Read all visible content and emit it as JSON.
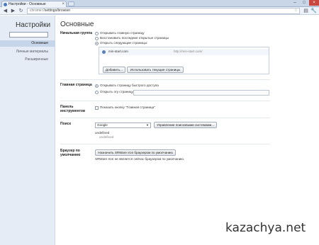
{
  "window": {
    "tab_title": "Настройки - Основные",
    "tab_close": "×",
    "controls": {
      "minimize": "–",
      "maximize": "□",
      "close": "×"
    }
  },
  "toolbar": {
    "back": "◀",
    "forward": "▶",
    "reload": "↻",
    "url_scheme": "chrome://",
    "url_path": "settings/browser",
    "star": "☆",
    "page_menu": "▤",
    "wrench": "🔧"
  },
  "sidebar": {
    "title": "Настройки",
    "items": [
      {
        "label": "Основные",
        "active": true
      },
      {
        "label": "Личные материалы",
        "active": false
      },
      {
        "label": "Расширенные",
        "active": false
      }
    ]
  },
  "main": {
    "title": "Основные",
    "startup": {
      "label": "Начальная группа",
      "options": [
        {
          "label": "Открывать главную страницу",
          "selected": false
        },
        {
          "label": "Восстановить последние открытые страницы",
          "selected": false
        },
        {
          "label": "Открыть следующие страницы:",
          "selected": true
        }
      ],
      "pages": [
        {
          "name": "min-start.com",
          "url": "http://min-start.com/"
        }
      ],
      "add_button": "Добавить...",
      "use_current_button": "Использовать текущие страницы"
    },
    "homepage": {
      "label": "Главная страница",
      "options": [
        {
          "label": "Открывать страницу быстрого доступа",
          "selected": true
        },
        {
          "label": "Открыть эту страницу:",
          "selected": false
        }
      ],
      "input_value": ""
    },
    "toolbar_section": {
      "label_line1": "Панель",
      "label_line2": "инструментов",
      "checkbox_label": "Показать кнопку \"Главная страница\"",
      "checked": false
    },
    "search": {
      "label": "Поиск",
      "engine": "Google",
      "manage_button": "Управление поисковыми системами...",
      "undefined_1": "undefined",
      "undefined_2": "undefined"
    },
    "default_browser": {
      "label_line1": "Браузер по",
      "label_line2": "умолчанию",
      "button": "Назначить SRWare Iron браузером по умолчанию",
      "status": "SRWare Iron не является сейчас браузером по умолчанию."
    }
  },
  "watermark": "kazachya.net"
}
